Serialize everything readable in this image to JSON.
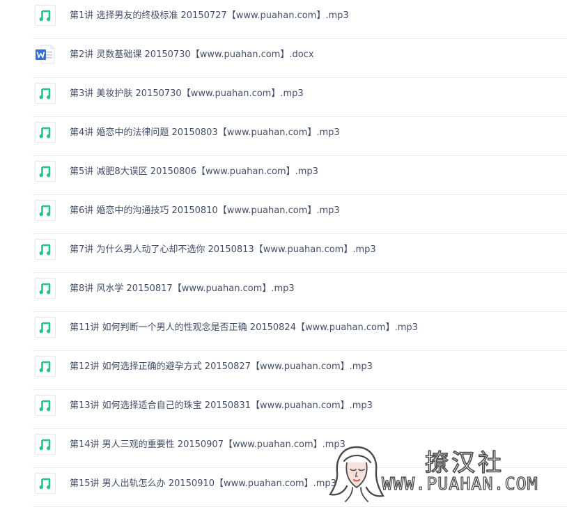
{
  "files": [
    {
      "name": "第1讲 选择男友的终极标准 20150727【www.puahan.com】.mp3",
      "type": "audio",
      "icon": "music-file-icon"
    },
    {
      "name": "第2讲 灵数基础课 20150730【www.puahan.com】.docx",
      "type": "word",
      "icon": "word-file-icon"
    },
    {
      "name": "第3讲 美妆护肤 20150730【www.puahan.com】.mp3",
      "type": "audio",
      "icon": "music-file-icon"
    },
    {
      "name": "第4讲 婚恋中的法律问题 20150803【www.puahan.com】.mp3",
      "type": "audio",
      "icon": "music-file-icon"
    },
    {
      "name": "第5讲 减肥8大误区 20150806【www.puahan.com】.mp3",
      "type": "audio",
      "icon": "music-file-icon"
    },
    {
      "name": "第6讲 婚恋中的沟通技巧 20150810【www.puahan.com】.mp3",
      "type": "audio",
      "icon": "music-file-icon"
    },
    {
      "name": "第7讲 为什么男人动了心却不选你 20150813【www.puahan.com】.mp3",
      "type": "audio",
      "icon": "music-file-icon"
    },
    {
      "name": "第8讲 风水学 20150817【www.puahan.com】.mp3",
      "type": "audio",
      "icon": "music-file-icon"
    },
    {
      "name": "第11讲 如何判断一个男人的性观念是否正确 20150824【www.puahan.com】.mp3",
      "type": "audio",
      "icon": "music-file-icon"
    },
    {
      "name": "第12讲 如何选择正确的避孕方式 20150827【www.puahan.com】.mp3",
      "type": "audio",
      "icon": "music-file-icon"
    },
    {
      "name": "第13讲 如何选择适合自己的珠宝 20150831【www.puahan.com】.mp3",
      "type": "audio",
      "icon": "music-file-icon"
    },
    {
      "name": "第14讲 男人三观的重要性 20150907【www.puahan.com】.mp3",
      "type": "audio",
      "icon": "music-file-icon"
    },
    {
      "name": "第15讲 男人出轨怎么办 20150910【www.puahan.com】.mp3",
      "type": "audio",
      "icon": "music-file-icon"
    }
  ],
  "watermark": {
    "title": "撩汉社",
    "url": "WWW.PUAHAN.COM",
    "icon": "woman-face-logo-icon"
  },
  "colors": {
    "text": "#424e67",
    "music_icon": "#1fc48a",
    "word_icon": "#2f6fd6",
    "divider": "#eef0f4",
    "icon_border": "#e3e6eb"
  }
}
